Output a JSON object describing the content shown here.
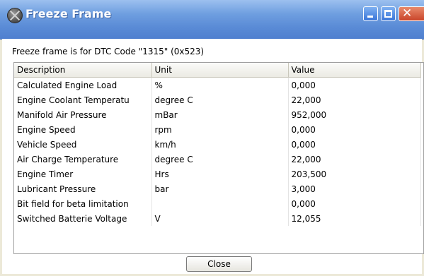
{
  "window": {
    "title": "Freeze Frame",
    "title_bar_color": "#5a8bd6",
    "close_button_color": "#c9452a"
  },
  "caption": "Freeze frame is for DTC Code \"1315\" (0x523)",
  "table": {
    "headers": [
      "Description",
      "Unit",
      "Value"
    ],
    "rows": [
      [
        "Calculated Engine Load",
        "%",
        "0,000"
      ],
      [
        "Engine Coolant Temperatu",
        "degree C",
        "22,000"
      ],
      [
        "Manifold Air Pressure",
        "mBar",
        "952,000"
      ],
      [
        "Engine Speed",
        "rpm",
        "0,000"
      ],
      [
        "Vehicle Speed",
        "km/h",
        "0,000"
      ],
      [
        "Air Charge Temperature",
        "degree C",
        "22,000"
      ],
      [
        "Engine Timer",
        "Hrs",
        "203,500"
      ],
      [
        "Lubricant Pressure",
        "bar",
        "3,000"
      ],
      [
        "Bit field for beta limitation",
        "",
        "0,000"
      ],
      [
        "Switched Batterie Voltage",
        "V",
        "12,055"
      ]
    ]
  },
  "close_button_label": "Close",
  "icons": {
    "app": "wheel-icon",
    "minimize": "minimize-icon",
    "maximize": "maximize-icon",
    "close": "close-icon"
  }
}
